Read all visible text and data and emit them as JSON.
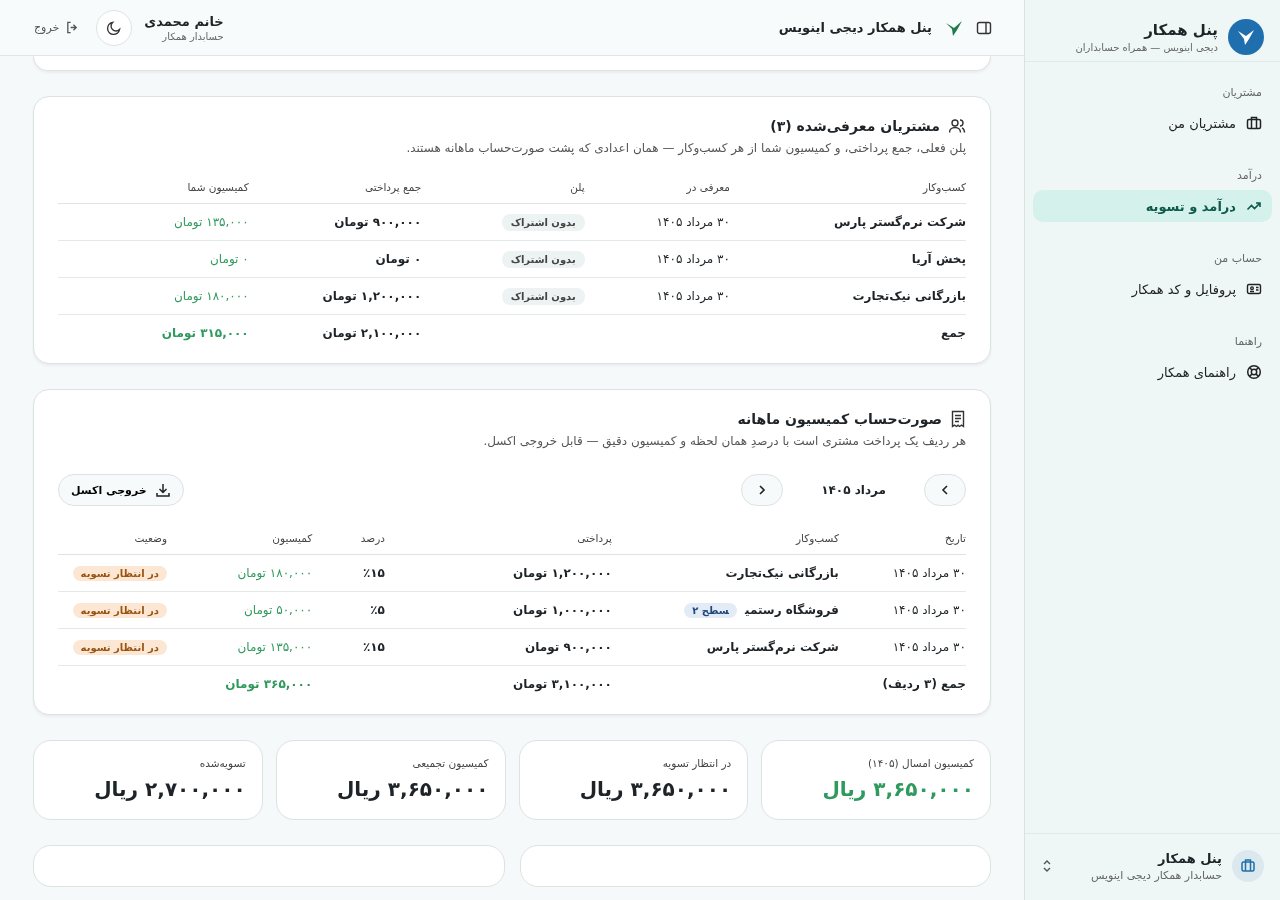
{
  "sidebar": {
    "brand": {
      "title": "پنل همکار",
      "subtitle": "دیجی اینویس — همراه حسابداران"
    },
    "sections": [
      {
        "heading": "مشتریان",
        "items": [
          {
            "label": "مشتریان من",
            "selected": false
          }
        ]
      },
      {
        "heading": "درآمد",
        "items": [
          {
            "label": "درآمد و تسویه",
            "selected": true
          }
        ]
      },
      {
        "heading": "حساب من",
        "items": [
          {
            "label": "پروفایل و کد همکار",
            "selected": false
          }
        ]
      },
      {
        "heading": "راهنما",
        "items": [
          {
            "label": "راهنمای همکار",
            "selected": false
          }
        ]
      }
    ],
    "footer": {
      "title": "پنل همکار",
      "subtitle": "حسابدار همکار دیجی اینویس"
    }
  },
  "header": {
    "title": "پنل همکار دیجی اینویس",
    "user": {
      "name": "خانم محمدی",
      "role": "حسابدار همکار"
    },
    "logout": "خروج"
  },
  "referred": {
    "title": "مشتریان معرفی‌شده (۳)",
    "description": "پلن فعلی، جمع پرداختی، و کمیسیون شما از هر کسب‌وکار — همان اعدادی که پشت صورت‌حساب ماهانه هستند.",
    "columns": [
      "کسب‌وکار",
      "معرفی در",
      "پلن",
      "جمع پرداختی",
      "کمیسیون شما"
    ],
    "rows": [
      {
        "business": "شرکت نرم‌گستر پارس",
        "date": "۳۰ مرداد ۱۴۰۵",
        "plan": "بدون اشتراک",
        "paid": "۹۰۰,۰۰۰ تومان",
        "commission": "۱۳۵,۰۰۰ تومان"
      },
      {
        "business": "پخش آریا",
        "date": "۳۰ مرداد ۱۴۰۵",
        "plan": "بدون اشتراک",
        "paid": "۰ تومان",
        "commission": "۰ تومان"
      },
      {
        "business": "بازرگانی نیک‌تجارت",
        "date": "۳۰ مرداد ۱۴۰۵",
        "plan": "بدون اشتراک",
        "paid": "۱,۲۰۰,۰۰۰ تومان",
        "commission": "۱۸۰,۰۰۰ تومان"
      }
    ],
    "total": {
      "label": "جمع",
      "paid": "۲,۱۰۰,۰۰۰ تومان",
      "commission": "۳۱۵,۰۰۰ تومان"
    }
  },
  "statement": {
    "title": "صورت‌حساب کمیسیون ماهانه",
    "description": "هر ردیف یک پرداخت مشتری است با درصدِ همان لحظه و کمیسیون دقیق — قابل خروجی اکسل.",
    "month": "مرداد ۱۴۰۵",
    "export": "خروجی اکسل",
    "columns": [
      "تاریخ",
      "کسب‌وکار",
      "پرداختی",
      "درصد",
      "کمیسیون",
      "وضعیت"
    ],
    "rows": [
      {
        "date": "۳۰ مرداد ۱۴۰۵",
        "business": "بازرگانی نیک‌تجارت",
        "paid": "۱,۲۰۰,۰۰۰ تومان",
        "percent": "٪۱۵",
        "commission": "۱۸۰,۰۰۰ تومان",
        "status": "در انتظار تسویه"
      },
      {
        "date": "۳۰ مرداد ۱۴۰۵",
        "business": "فروشگاه رستمی",
        "level": "سطح ۲",
        "paid": "۱,۰۰۰,۰۰۰ تومان",
        "percent": "٪۵",
        "commission": "۵۰,۰۰۰ تومان",
        "status": "در انتظار تسویه"
      },
      {
        "date": "۳۰ مرداد ۱۴۰۵",
        "business": "شرکت نرم‌گستر پارس",
        "paid": "۹۰۰,۰۰۰ تومان",
        "percent": "٪۱۵",
        "commission": "۱۳۵,۰۰۰ تومان",
        "status": "در انتظار تسویه"
      }
    ],
    "total": {
      "label": "جمع (۳ ردیف)",
      "paid": "۳,۱۰۰,۰۰۰ تومان",
      "commission": "۳۶۵,۰۰۰ تومان"
    }
  },
  "stats": [
    {
      "label": "کمیسیون امسال (۱۴۰۵)",
      "value": "۳,۶۵۰,۰۰۰ ریال",
      "highlight": true
    },
    {
      "label": "در انتظار تسویه",
      "value": "۳,۶۵۰,۰۰۰ ریال",
      "highlight": false
    },
    {
      "label": "کمیسیون تجمیعی",
      "value": "۳,۶۵۰,۰۰۰ ریال",
      "highlight": false
    },
    {
      "label": "تسویه‌شده",
      "value": "۲,۷۰۰,۰۰۰ ریال",
      "highlight": false
    }
  ]
}
